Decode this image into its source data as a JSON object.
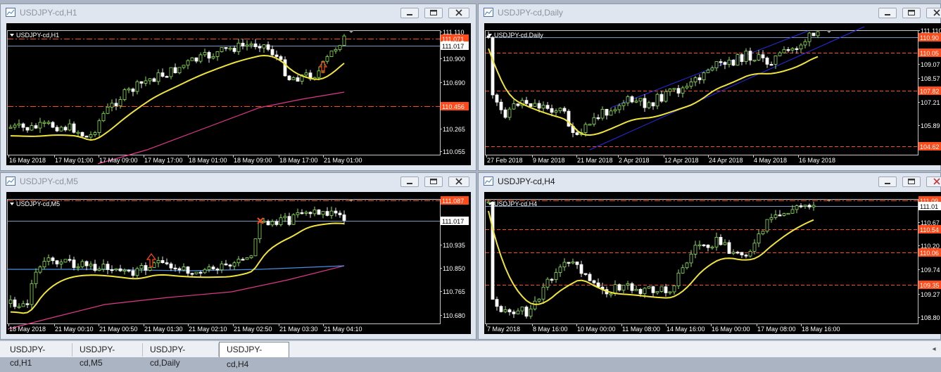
{
  "colors": {
    "background": "#000000",
    "grid_text": "#ffffff",
    "bull": "#000000",
    "bull_outline": "#8fe25c",
    "bear": "#ffffff",
    "ma_fast": "#f0e33b",
    "ma_slow": "#e0388a",
    "ma_blue": "#4a90e2",
    "level": "#ff4a1a",
    "bid_line": "#7b99c2",
    "channel": "#2b2be6",
    "hline_red": "#e03030"
  },
  "tabs": [
    {
      "label": "USDJPY-cd,H1"
    },
    {
      "label": "USDJPY-cd,M5"
    },
    {
      "label": "USDJPY-cd,Daily"
    },
    {
      "label": "USDJPY-cd,H4"
    }
  ],
  "active_tab": 3,
  "windows": [
    {
      "title": "USDJPY-cd,H1",
      "chart_label": "USDJPY-cd,H1",
      "price_labels": [
        "111.110",
        "111.071",
        "111.017",
        "110.900",
        "110.690",
        "110.456",
        "110.265",
        "110.055"
      ],
      "highlight_labels": [
        "111.071",
        "110.456"
      ],
      "time_labels": [
        "16 May 2018",
        "17 May 01:00",
        "17 May 09:00",
        "17 May 17:00",
        "18 May 01:00",
        "18 May 09:00",
        "18 May 17:00",
        "21 May 01:00"
      ]
    },
    {
      "title": "USDJPY-cd,Daily",
      "chart_label": "USDJPY-cd,Daily",
      "price_labels": [
        "111.110",
        "110.90",
        "110.05",
        "109.07",
        "108.57",
        "107.82",
        "107.21",
        "105.89",
        "104.62"
      ],
      "highlight_labels": [
        "110.90",
        "110.05",
        "107.82",
        "104.62"
      ],
      "time_labels": [
        "27 Feb 2018",
        "9 Mar 2018",
        "21 Mar 2018",
        "2 Apr 2018",
        "12 Apr 2018",
        "24 Apr 2018",
        "4 May 2018",
        "16 May 2018"
      ]
    },
    {
      "title": "USDJPY-cd,M5",
      "chart_label": "USDJPY-cd,M5",
      "price_labels": [
        "111.087",
        "111.017",
        "110.935",
        "110.850",
        "110.765",
        "110.680"
      ],
      "highlight_labels": [
        "111.087"
      ],
      "time_labels": [
        "18 May 2018",
        "21 May 00:10",
        "21 May 00:50",
        "21 May 01:30",
        "21 May 02:10",
        "21 May 02:50",
        "21 May 03:30",
        "21 May 04:10"
      ]
    },
    {
      "title": "USDJPY-cd,H4",
      "chart_label": "USDJPY-cd,H4",
      "price_labels": [
        "111.09",
        "111.01",
        "110.67",
        "110.54",
        "110.20",
        "110.06",
        "109.74",
        "109.35",
        "109.27",
        "108.80"
      ],
      "highlight_labels": [
        "111.09",
        "110.54",
        "110.06",
        "109.35"
      ],
      "time_labels": [
        "7 May 2018",
        "8 May 16:00",
        "10 May 00:00",
        "11 May 08:00",
        "14 May 16:00",
        "16 May 00:00",
        "17 May 08:00",
        "18 May 16:00"
      ]
    }
  ]
}
